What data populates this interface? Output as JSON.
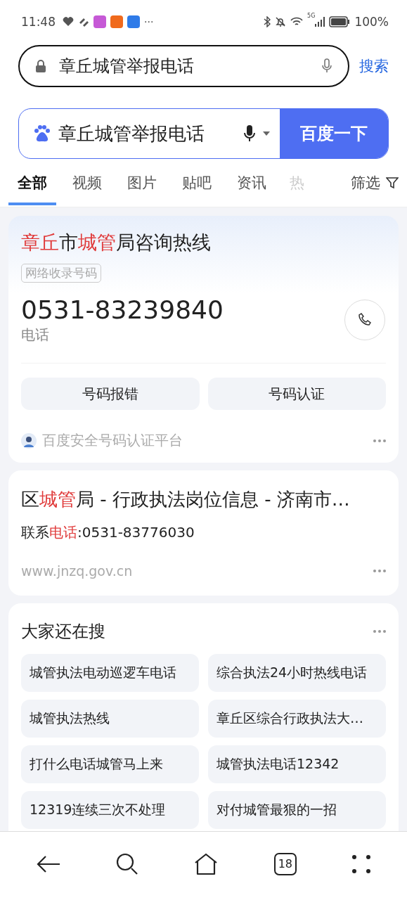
{
  "status_bar": {
    "time": "11:48",
    "more": "···",
    "battery": "100%",
    "network": "5G"
  },
  "url_bar": {
    "value": "章丘城管举报电话",
    "action": "搜索"
  },
  "search": {
    "value": "章丘城管举报电话",
    "button": "百度一下"
  },
  "tabs": [
    {
      "label": "全部",
      "selected": true
    },
    {
      "label": "视频",
      "selected": false
    },
    {
      "label": "图片",
      "selected": false
    },
    {
      "label": "贴吧",
      "selected": false
    },
    {
      "label": "资讯",
      "selected": false
    },
    {
      "label": "热",
      "selected": false,
      "faded": true
    }
  ],
  "filter": {
    "label": "筛选"
  },
  "phone_card": {
    "title": [
      {
        "text": "章丘",
        "hl": true
      },
      {
        "text": "市",
        "hl": false
      },
      {
        "text": "城管",
        "hl": true
      },
      {
        "text": "局咨询热线",
        "hl": false
      }
    ],
    "tag": "网络收录号码",
    "number": "0531-83239840",
    "number_label": "电话",
    "buttons": [
      "号码报错",
      "号码认证"
    ],
    "source": "百度安全号码认证平台"
  },
  "result": {
    "title": [
      {
        "text": "区",
        "hl": false
      },
      {
        "text": "城管",
        "hl": true
      },
      {
        "text": "局 - 行政执法岗位信息 - 济南市…",
        "hl": false
      }
    ],
    "snippet": [
      {
        "text": "联系",
        "hl": false
      },
      {
        "text": "电话",
        "hl": true
      },
      {
        "text": ":0531-83776030",
        "hl": false
      }
    ],
    "url": "www.jnzq.gov.cn"
  },
  "related": {
    "title": "大家还在搜",
    "items": [
      "城管执法电动巡逻车电话",
      "综合执法24小时热线电话",
      "城管执法热线",
      "章丘区综合行政执法大…",
      "打什么电话城管马上来",
      "城管执法电话12342",
      "12319连续三次不处理",
      "对付城管最狠的一招"
    ]
  },
  "bottom_nav": {
    "tab_count": "18"
  }
}
